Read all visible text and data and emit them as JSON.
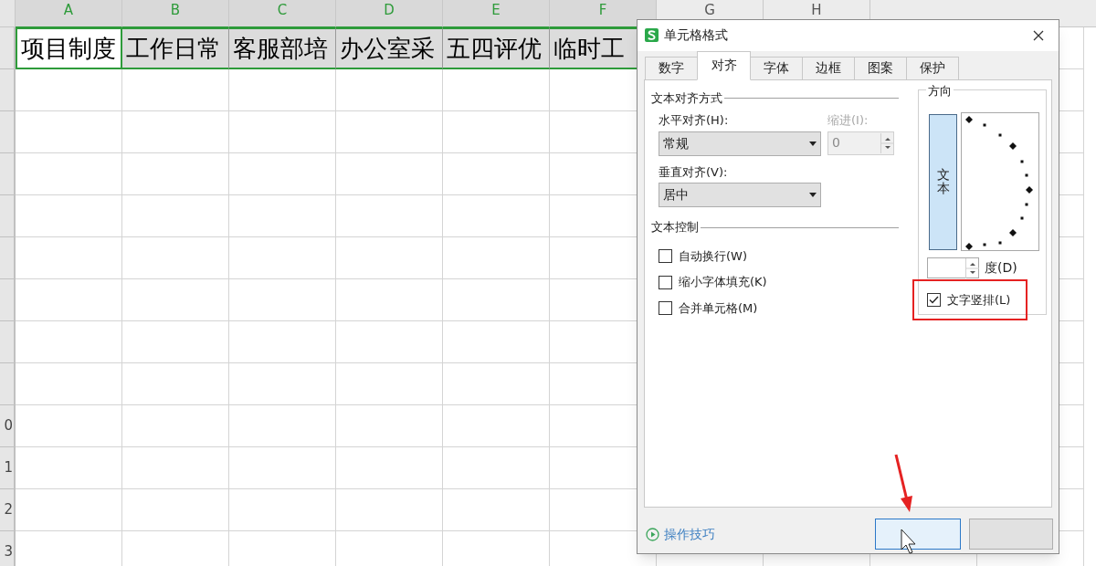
{
  "spreadsheet": {
    "columns": [
      {
        "label": "A",
        "selected": true
      },
      {
        "label": "B",
        "selected": true
      },
      {
        "label": "C",
        "selected": true
      },
      {
        "label": "D",
        "selected": true
      },
      {
        "label": "E",
        "selected": true
      },
      {
        "label": "F",
        "selected": true
      },
      {
        "label": "G",
        "selected": false
      },
      {
        "label": "H",
        "selected": false
      }
    ],
    "row_headers_visible": [
      "0",
      "1",
      "2",
      "3"
    ],
    "cells": [
      {
        "text": "项目制度",
        "active": true
      },
      {
        "text": "工作日常",
        "active": false
      },
      {
        "text": "客服部培",
        "active": false
      },
      {
        "text": "办公室采",
        "active": false
      },
      {
        "text": "五四评优",
        "active": false
      },
      {
        "text": "临时工",
        "active": false
      }
    ]
  },
  "dialog": {
    "title": "单元格格式",
    "tabs": [
      {
        "label": "数字",
        "selected": false
      },
      {
        "label": "对齐",
        "selected": true
      },
      {
        "label": "字体",
        "selected": false
      },
      {
        "label": "边框",
        "selected": false
      },
      {
        "label": "图案",
        "selected": false
      },
      {
        "label": "保护",
        "selected": false
      }
    ],
    "alignment_group": {
      "title": "文本对齐方式",
      "horizontal": {
        "label": "水平对齐(H):",
        "value": "常规"
      },
      "indent": {
        "label": "缩进(I):",
        "value": "0",
        "disabled": true
      },
      "vertical": {
        "label": "垂直对齐(V):",
        "value": "居中"
      }
    },
    "text_control": {
      "title": "文本控制",
      "options": [
        {
          "label": "自动换行(W)",
          "checked": false
        },
        {
          "label": "缩小字体填充(K)",
          "checked": false
        },
        {
          "label": "合并单元格(M)",
          "checked": false
        }
      ]
    },
    "orientation": {
      "title": "方向",
      "sample_text": "文本",
      "degrees_label": "度(D)",
      "vertical_text": {
        "label": "文字竖排(L)",
        "checked": true
      }
    },
    "tips_link": "操作技巧"
  }
}
